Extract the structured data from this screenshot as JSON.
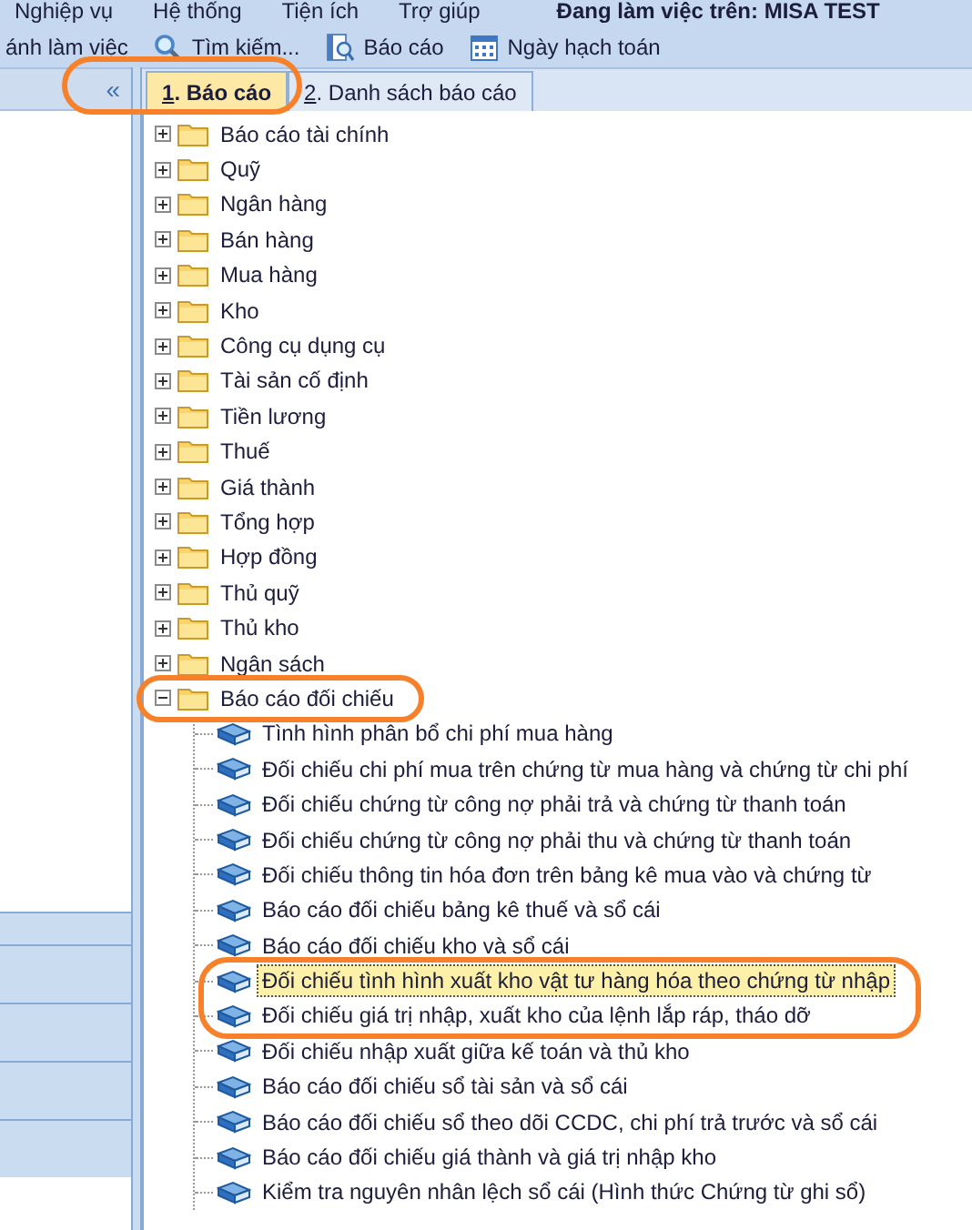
{
  "menu": [
    {
      "label": "Nghiệp vụ"
    },
    {
      "label": "Hệ thống"
    },
    {
      "label": "Tiện ích"
    },
    {
      "label": "Trợ giúp"
    }
  ],
  "workspace": "Đang làm việc trên:  MISA TEST",
  "toolbar": [
    {
      "kind": "text",
      "label": "ánh làm việc"
    },
    {
      "kind": "search",
      "label": "Tìm kiếm..."
    },
    {
      "kind": "report",
      "label": "Báo cáo"
    },
    {
      "kind": "calendar",
      "label": "Ngày hạch toán"
    }
  ],
  "sidebar": {
    "collapse_button": "«"
  },
  "tabs": [
    {
      "hotkey": "1",
      "label": ". Báo cáo",
      "selected": true,
      "annotated": true
    },
    {
      "hotkey": "2",
      "label": ". Danh sách báo cáo",
      "selected": false,
      "annotated": false
    }
  ],
  "tree": [
    {
      "label": "Báo cáo tài chính",
      "expanded": false,
      "selected": false,
      "annotated": false
    },
    {
      "label": "Quỹ",
      "expanded": false,
      "selected": false,
      "annotated": false
    },
    {
      "label": "Ngân hàng",
      "expanded": false,
      "selected": false,
      "annotated": false
    },
    {
      "label": "Bán hàng",
      "expanded": false,
      "selected": false,
      "annotated": false
    },
    {
      "label": "Mua hàng",
      "expanded": false,
      "selected": false,
      "annotated": false
    },
    {
      "label": "Kho",
      "expanded": false,
      "selected": false,
      "annotated": false
    },
    {
      "label": "Công cụ dụng cụ",
      "expanded": false,
      "selected": false,
      "annotated": false
    },
    {
      "label": "Tài sản cố định",
      "expanded": false,
      "selected": false,
      "annotated": false
    },
    {
      "label": "Tiền lương",
      "expanded": false,
      "selected": false,
      "annotated": false
    },
    {
      "label": "Thuế",
      "expanded": false,
      "selected": false,
      "annotated": false
    },
    {
      "label": "Giá thành",
      "expanded": false,
      "selected": false,
      "annotated": false
    },
    {
      "label": "Tổng hợp",
      "expanded": false,
      "selected": false,
      "annotated": false
    },
    {
      "label": "Hợp đồng",
      "expanded": false,
      "selected": false,
      "annotated": false
    },
    {
      "label": "Thủ quỹ",
      "expanded": false,
      "selected": false,
      "annotated": false
    },
    {
      "label": "Thủ kho",
      "expanded": false,
      "selected": false,
      "annotated": false
    },
    {
      "label": "Ngân sách",
      "expanded": false,
      "selected": false,
      "annotated": false
    },
    {
      "label": "Báo cáo đối chiếu",
      "expanded": true,
      "selected": false,
      "annotated": true,
      "children": [
        {
          "label": "Tình hình phân bổ chi phí mua hàng",
          "selected": false,
          "annotated": false
        },
        {
          "label": "Đối chiếu chi phí mua trên chứng từ mua hàng và chứng từ chi phí",
          "selected": false,
          "annotated": false
        },
        {
          "label": "Đối chiếu chứng từ công nợ phải trả và chứng từ thanh toán",
          "selected": false,
          "annotated": false
        },
        {
          "label": "Đối chiếu chứng từ công nợ phải thu và chứng từ thanh toán",
          "selected": false,
          "annotated": false
        },
        {
          "label": "Đối chiếu thông tin hóa đơn trên bảng kê mua vào và chứng từ",
          "selected": false,
          "annotated": false
        },
        {
          "label": "Báo cáo đối chiếu bảng kê thuế và sổ cái",
          "selected": false,
          "annotated": false
        },
        {
          "label": "Báo cáo đối chiếu kho và sổ cái",
          "selected": false,
          "annotated": false
        },
        {
          "label": "Đối chiếu tình hình xuất kho vật tư hàng hóa theo chứng từ nhập",
          "selected": true,
          "annotated": true
        },
        {
          "label": "Đối chiếu giá trị nhập, xuất kho của lệnh lắp ráp, tháo dỡ",
          "selected": false,
          "annotated": true
        },
        {
          "label": "Đối chiếu nhập xuất giữa kế toán và thủ kho",
          "selected": false,
          "annotated": false
        },
        {
          "label": "Báo cáo đối chiếu sổ tài sản và sổ cái",
          "selected": false,
          "annotated": false
        },
        {
          "label": "Báo cáo đối chiếu sổ theo dõi CCDC, chi phí trả trước và sổ cái",
          "selected": false,
          "annotated": false
        },
        {
          "label": "Báo cáo đối chiếu giá thành và giá trị nhập kho",
          "selected": false,
          "annotated": false
        },
        {
          "label": "Kiểm tra nguyên nhân lệch sổ cái (Hình thức Chứng từ ghi sổ)",
          "selected": false,
          "annotated": false
        }
      ]
    }
  ]
}
